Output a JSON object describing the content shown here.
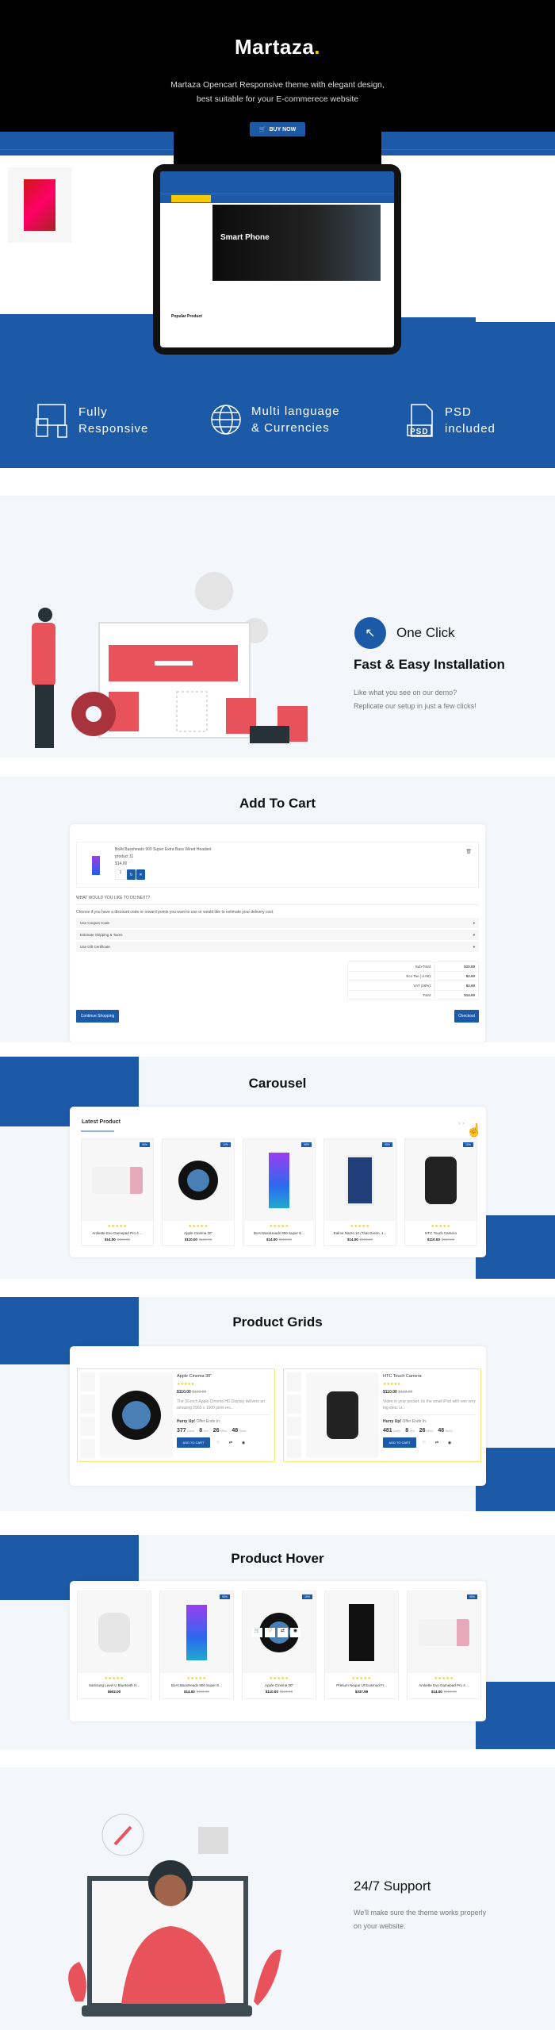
{
  "hero": {
    "brand": "Martaza",
    "brand_dot": ".",
    "subtitle_line1": "Martaza Opencart Responsive theme with elegant design,",
    "subtitle_line2": "best suitable for your E-commerece website",
    "buy_now": "BUY NOW",
    "banner_title": "Smart Phone",
    "popular": "Popular Product"
  },
  "features": [
    {
      "icon": "responsive-devices-icon",
      "line1": "Fully",
      "line2": "Responsive"
    },
    {
      "icon": "globe-icon",
      "line1": "Multi language",
      "line2": "& Currencies"
    },
    {
      "icon": "psd-file-icon",
      "line1": "PSD",
      "line2": "included"
    }
  ],
  "install": {
    "title": "One Click",
    "heading": "Fast & Easy Installation",
    "desc1": "Like what you see on our demo?",
    "desc2": "Replicate our setup in just a few clicks!"
  },
  "cart": {
    "title": "Add To Cart",
    "item_name": "BoAt Bassheads 900 Super Extra Bass Wired Headset",
    "item_model": "product 11",
    "item_price": "$14.00",
    "qty": "1",
    "next_heading": "WHAT WOULD YOU LIKE TO DO NEXT?",
    "next_desc": "Choose if you have a discount code or reward points you want to use or would like to estimate your delivery cost.",
    "accordions": [
      "Use Coupon Code",
      "Estimate Shipping & Taxes",
      "Use Gift Certificate"
    ],
    "totals": [
      {
        "label": "Sub-Total:",
        "value": "$10.00"
      },
      {
        "label": "Eco Tax (-2.00):",
        "value": "$2.00"
      },
      {
        "label": "VAT (20%):",
        "value": "$2.00"
      },
      {
        "label": "Total:",
        "value": "$14.00"
      }
    ],
    "continue": "Continue Shopping",
    "checkout": "Checkout"
  },
  "carousel": {
    "title": "Carousel",
    "section": "Latest Product",
    "products": [
      {
        "name": "Amkette Evo Gamepad Pro 4 ...",
        "price": "$14.00",
        "old": "$122.00",
        "badge": "90%",
        "img": "microwave"
      },
      {
        "name": "Apple Cinema 30\"",
        "price": "$110.00",
        "old": "$122.00",
        "badge": "10%",
        "img": "speaker-round"
      },
      {
        "name": "BoAt BassHeads 900 Super E...",
        "price": "$14.00",
        "old": "$122.00",
        "badge": "90%",
        "img": "phone"
      },
      {
        "name": "Ealme Narzo 10 (That Green, 1...",
        "price": "$14.00",
        "old": "$122.00",
        "badge": "90%",
        "img": "tablet"
      },
      {
        "name": "HTC Touch Camera",
        "price": "$110.00",
        "old": "$122.00",
        "badge": "10%",
        "img": "watch"
      }
    ]
  },
  "grids": {
    "title": "Product Grids",
    "items": [
      {
        "name": "Apple Cinema 30\"",
        "price": "$110.00",
        "old": "$122.00",
        "desc": "The 30-inch Apple Cinema HD Display delivers an amazing 2560 x 1600 pixel res...",
        "hurry": "Hurry Up!",
        "offer": "Offer Ends In:",
        "days": "377",
        "hrs": "8",
        "mins": "26",
        "secs": "48"
      },
      {
        "name": "HTC Touch Camera",
        "price": "$110.00",
        "old": "$122.00",
        "desc": "Video in your pocket. Its the small iPod with one very big idea: vi...",
        "hurry": "Hurry Up!",
        "offer": "Offer Ends In:",
        "days": "481",
        "hrs": "8",
        "mins": "26",
        "secs": "48"
      }
    ],
    "units": {
      "days": "Days",
      "hrs": "Hrs",
      "mins": "Mins",
      "secs": "Secs"
    },
    "add_to_cart": "ADD TO CART"
  },
  "hover": {
    "title": "Product Hover",
    "products": [
      {
        "name": "Samsung Level U Bluetooth H...",
        "price": "$602.00",
        "old": "",
        "badge": ""
      },
      {
        "name": "BoAt BassHeads 900 Super E...",
        "price": "$14.00",
        "old": "$122.00",
        "badge": "90%"
      },
      {
        "name": "Apple Cinema 30\"",
        "price": "$110.00",
        "old": "$122.00",
        "badge": "10%"
      },
      {
        "name": "Pretium Neque Ut Euismod Fr...",
        "price": "$337.99",
        "old": "",
        "badge": ""
      },
      {
        "name": "Amkette Evo Gamepad Pro 4 ...",
        "price": "$14.00",
        "old": "$122.00",
        "badge": "90%"
      }
    ]
  },
  "support": {
    "title": "24/7 Support",
    "desc1": "We'll make sure the theme works properly",
    "desc2": "on your website."
  },
  "colors": {
    "primary": "#1c5aa8",
    "accent": "#f5c800",
    "illustration": "#e8525b"
  }
}
